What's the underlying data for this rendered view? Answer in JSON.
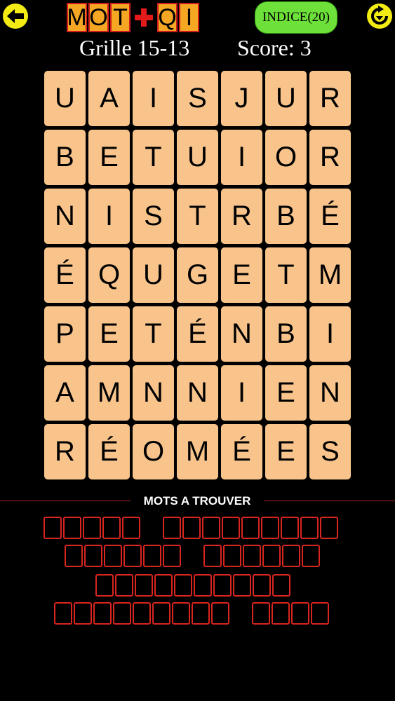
{
  "header": {
    "logo_letters": [
      "M",
      "O",
      "T",
      "+",
      "Q",
      "I"
    ],
    "hint_label": "INDICE(20)",
    "back_icon": "arrow-left-icon",
    "refresh_icon": "refresh-icon",
    "accent_color": "#f2ec14",
    "hint_color": "#6ee03a"
  },
  "status": {
    "grid_label": "Grille 15-13",
    "score_label": "Score: 3"
  },
  "board": {
    "rows": [
      [
        "U",
        "A",
        "I",
        "S",
        "J",
        "U",
        "R"
      ],
      [
        "B",
        "E",
        "T",
        "U",
        "I",
        "O",
        "R"
      ],
      [
        "N",
        "I",
        "S",
        "T",
        "R",
        "B",
        "É"
      ],
      [
        "É",
        "Q",
        "U",
        "G",
        "E",
        "T",
        "M"
      ],
      [
        "P",
        "E",
        "T",
        "É",
        "N",
        "B",
        "I"
      ],
      [
        "A",
        "M",
        "N",
        "N",
        "I",
        "E",
        "N"
      ],
      [
        "R",
        "É",
        "O",
        "M",
        "É",
        "E",
        "S"
      ]
    ],
    "tile_color": "#f8c48b"
  },
  "words": {
    "section_title": "MOTS A TROUVER",
    "rows": [
      [
        5,
        9
      ],
      [
        6,
        6
      ],
      [
        10
      ],
      [
        9,
        4
      ]
    ],
    "box_color": "#d8251f"
  }
}
